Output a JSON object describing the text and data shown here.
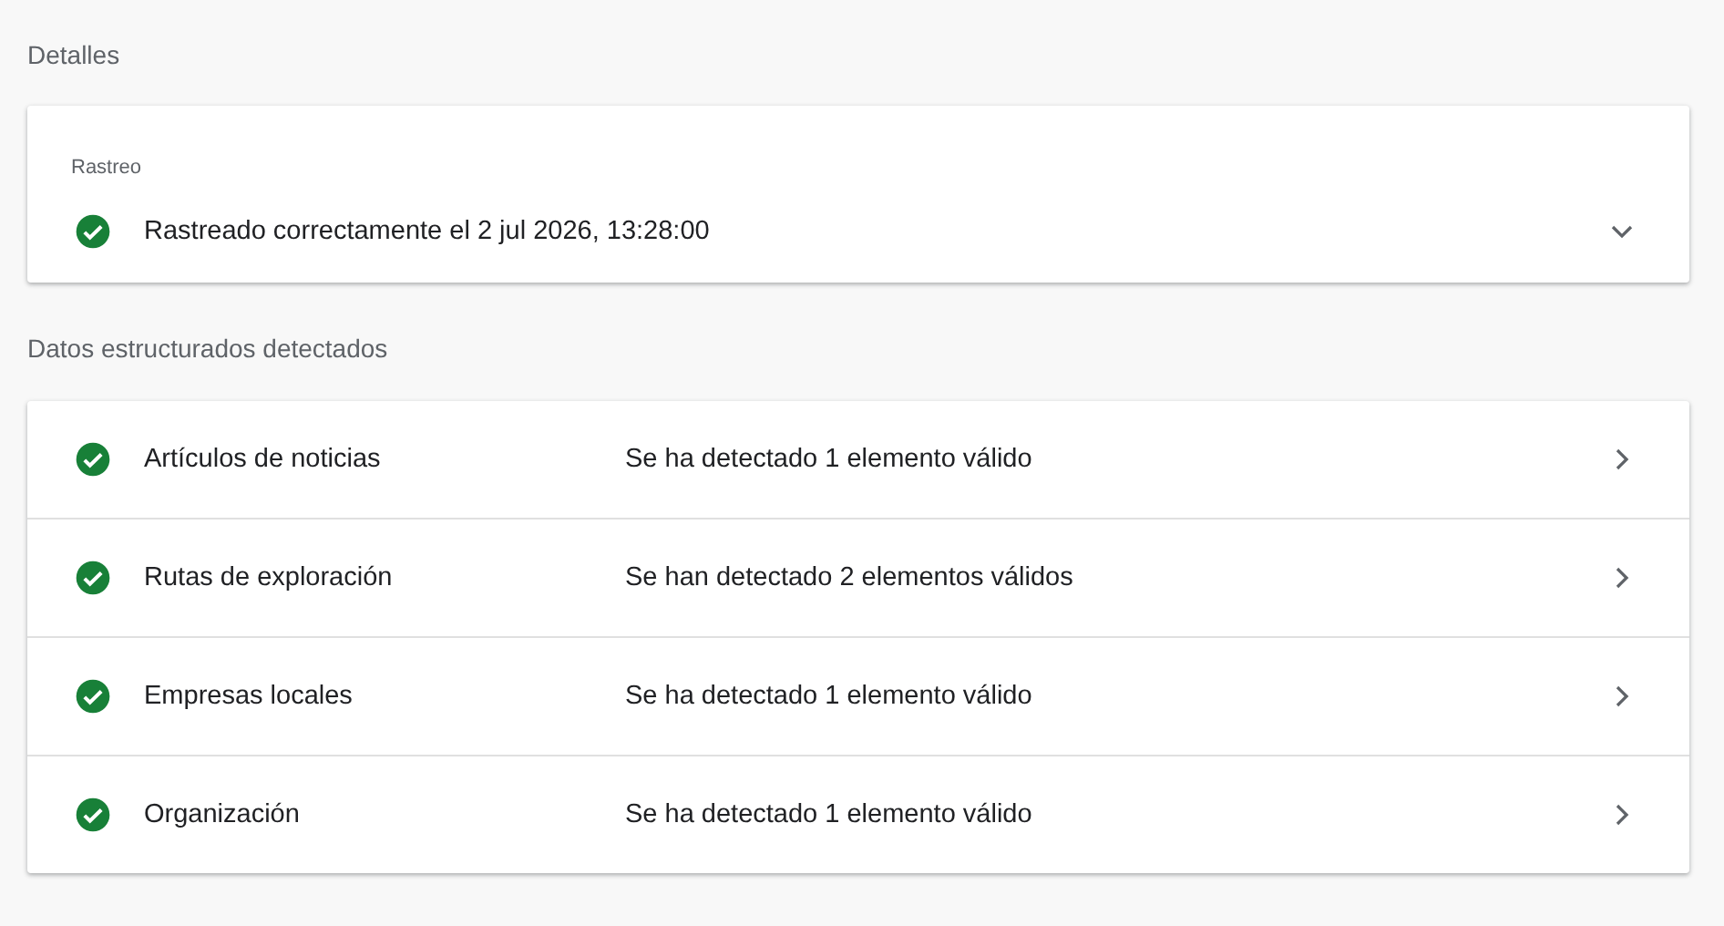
{
  "details": {
    "heading": "Detalles",
    "crawl": {
      "label": "Rastreo",
      "valid": true,
      "text": "Rastreado correctamente el 2 jul 2026, 13:28:00",
      "expanded": false
    }
  },
  "structured_data": {
    "heading": "Datos estructurados detectados",
    "items": [
      {
        "valid": true,
        "name": "Artículos de noticias",
        "result": "Se ha detectado 1 elemento válido"
      },
      {
        "valid": true,
        "name": "Rutas de exploración",
        "result": "Se han detectado 2 elementos válidos"
      },
      {
        "valid": true,
        "name": "Empresas locales",
        "result": "Se ha detectado 1 elemento válido"
      },
      {
        "valid": true,
        "name": "Organización",
        "result": "Se ha detectado 1 elemento válido"
      }
    ]
  }
}
